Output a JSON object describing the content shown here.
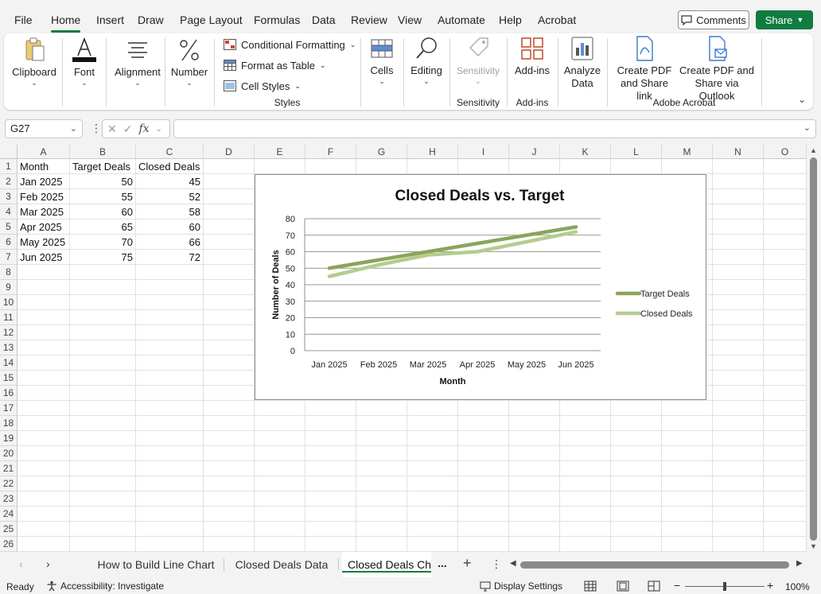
{
  "menu": {
    "tabs": [
      "File",
      "Home",
      "Insert",
      "Draw",
      "Page Layout",
      "Formulas",
      "Data",
      "Review",
      "View",
      "Automate",
      "Help",
      "Acrobat"
    ],
    "active_tab": "Home",
    "comments_label": "Comments",
    "share_label": "Share"
  },
  "ribbon": {
    "clipboard": "Clipboard",
    "font": "Font",
    "alignment": "Alignment",
    "number": "Number",
    "conditional_formatting": "Conditional Formatting",
    "format_as_table": "Format as Table",
    "cell_styles": "Cell Styles",
    "styles_group": "Styles",
    "cells": "Cells",
    "editing": "Editing",
    "sensitivity": "Sensitivity",
    "sensitivity_group": "Sensitivity",
    "addins": "Add-ins",
    "addins_group": "Add-ins",
    "analyze_line1": "Analyze",
    "analyze_line2": "Data",
    "pdf_link_line1": "Create PDF",
    "pdf_link_line2": "and Share link",
    "pdf_outlook_line1": "Create PDF and",
    "pdf_outlook_line2": "Share via Outlook",
    "acrobat_group": "Adobe Acrobat"
  },
  "formula_bar": {
    "name_box": "G27",
    "fx": "fx",
    "formula": ""
  },
  "columns": [
    "A",
    "B",
    "C",
    "D",
    "E",
    "F",
    "G",
    "H",
    "I",
    "J",
    "K",
    "L",
    "M",
    "N",
    "O"
  ],
  "rows": [
    "1",
    "2",
    "3",
    "4",
    "5",
    "6",
    "7",
    "8",
    "9",
    "10",
    "11",
    "12",
    "13",
    "14",
    "15",
    "16",
    "17",
    "18",
    "19",
    "20",
    "21",
    "22",
    "23",
    "24",
    "25",
    "26"
  ],
  "table": {
    "headers": [
      "Month",
      "Target Deals",
      "Closed Deals"
    ],
    "rows": [
      [
        "Jan 2025",
        "50",
        "45"
      ],
      [
        "Feb 2025",
        "55",
        "52"
      ],
      [
        "Mar 2025",
        "60",
        "58"
      ],
      [
        "Apr 2025",
        "65",
        "60"
      ],
      [
        "May 2025",
        "70",
        "66"
      ],
      [
        "Jun 2025",
        "75",
        "72"
      ]
    ]
  },
  "chart_data": {
    "type": "line",
    "title": "Closed Deals vs. Target",
    "xlabel": "Month",
    "ylabel": "Number of Deals",
    "categories": [
      "Jan 2025",
      "Feb 2025",
      "Mar 2025",
      "Apr 2025",
      "May 2025",
      "Jun 2025"
    ],
    "series": [
      {
        "name": "Target Deals",
        "values": [
          50,
          55,
          60,
          65,
          70,
          75
        ],
        "color": "#8aa55a"
      },
      {
        "name": "Closed Deals",
        "values": [
          45,
          52,
          58,
          60,
          66,
          72
        ],
        "color": "#b5cc8e"
      }
    ],
    "ylim": [
      0,
      80
    ],
    "yticks": [
      0,
      10,
      20,
      30,
      40,
      50,
      60,
      70,
      80
    ],
    "grid": true,
    "legend": "right"
  },
  "sheets": {
    "tabs": [
      "How to Build Line Chart",
      "Closed Deals Data",
      "Closed Deals Cha"
    ],
    "active": "Closed Deals Cha",
    "more": "...",
    "add": "+"
  },
  "status": {
    "ready": "Ready",
    "accessibility": "Accessibility: Investigate",
    "display_settings": "Display Settings",
    "zoom": "100%"
  },
  "colors": {
    "accent": "#107c41",
    "target_line": "#8aa55a",
    "closed_line": "#b5cc8e"
  }
}
